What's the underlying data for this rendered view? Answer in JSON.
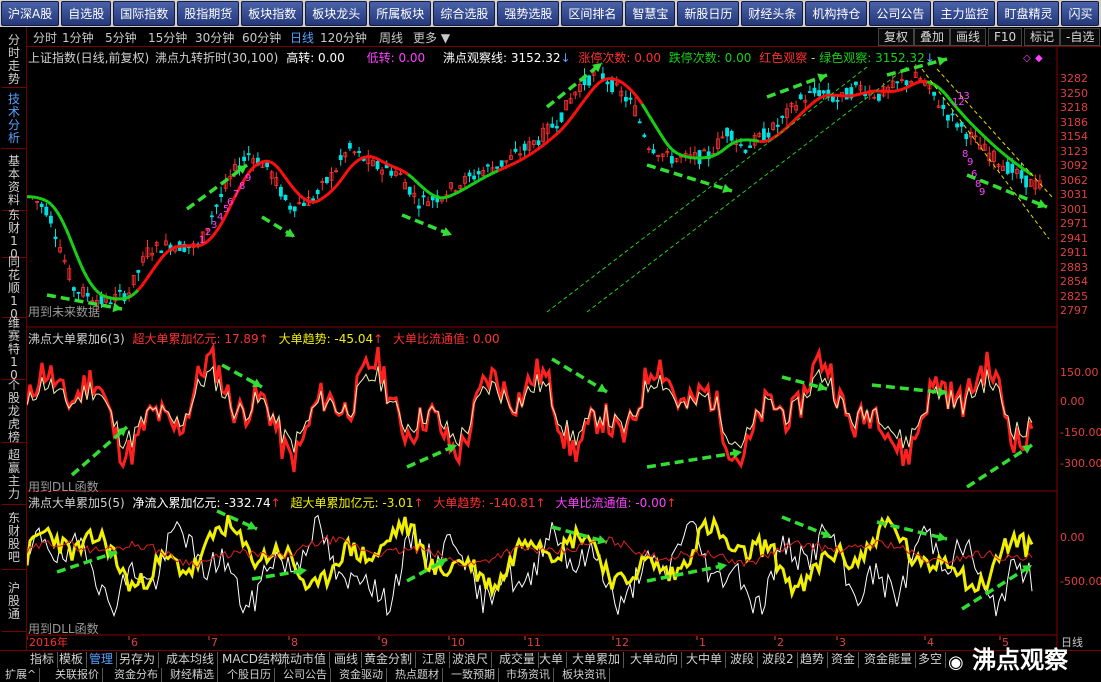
{
  "top_menu": [
    "沪深A股",
    "自选股",
    "国际指数",
    "股指期货",
    "板块指数",
    "板块龙头",
    "所属板块",
    "综合选股",
    "强势选股",
    "区间排名",
    "智慧宝",
    "新股日历",
    "财经头条",
    "机构持仓",
    "公司公告",
    "主力监控",
    "盯盘精灵",
    "闪买"
  ],
  "left_tabs": [
    "分时走势",
    "技术分析",
    "基本资料",
    "东财10",
    "同花顺10",
    "维赛特10",
    "个股龙虎榜",
    "超赢主力",
    "东财股吧",
    "沪股通"
  ],
  "period_bar": {
    "items": [
      "分时",
      "1分钟",
      "5分钟",
      "15分钟",
      "30分钟",
      "60分钟",
      "日线",
      "120分钟",
      "周线",
      "更多 ▼"
    ],
    "right_buttons": [
      "复权",
      "叠加",
      "画线",
      "F10",
      "标记",
      "-自选"
    ]
  },
  "panel1": {
    "title": "上证指数(日线,前复权)",
    "ind_name": "沸点九转折时(30,100)",
    "gaozhuan": "高转: 0.00",
    "dizhuan": "低转: 0.00",
    "guancha": "沸点观察线: 3152.32",
    "zhangting": "涨停次数: 0.00",
    "dieting": "跌停次数: 0.00",
    "red_obs": "红色观察",
    "green_obs": "绿色观察: 3152.32",
    "footer": "用到未来数据",
    "y_labels": [
      "3282",
      "3250",
      "3218",
      "3186",
      "3154",
      "3123",
      "3092",
      "3062",
      "3031",
      "3001",
      "2971",
      "2941",
      "2911",
      "2883",
      "2854",
      "2825",
      "2797"
    ],
    "seq_numbers": [
      "1",
      "2",
      "3",
      "4",
      "5",
      "6",
      "7",
      "8",
      "9",
      "12",
      "13",
      "8",
      "9",
      "6",
      "8",
      "9"
    ]
  },
  "panel2": {
    "title": "沸点大单累加6(3)",
    "c1": "超大单累加亿元: 17.89",
    "c2": "大单趋势: -45.04",
    "c3": "大单比流通值: 0.00",
    "footer": "用到DLL函数",
    "y_labels": [
      "150.00",
      "0.00",
      "-150.00",
      "-300.00"
    ]
  },
  "panel3": {
    "title": "沸点大单累加5(5)",
    "c1": "净流入累加亿元: -332.74",
    "c2": "超大单累加亿元: -3.01",
    "c3": "大单趋势: -140.81",
    "c4": "大单比流通值: -0.00",
    "footer": "用到DLL函数",
    "y_labels": [
      "0.00",
      "-500.00"
    ]
  },
  "x_axis": [
    "2016年",
    "6",
    "7",
    "8",
    "9",
    "10",
    "11",
    "12",
    "1",
    "2",
    "3",
    "4",
    "5"
  ],
  "x_axis_right": "日线",
  "bottom_tabs": [
    "指标",
    "模板",
    "管理",
    "另存为",
    "成本均线",
    "MACD结构",
    "流动市值",
    "画线",
    "黄金分割",
    "江恩",
    "波浪尺",
    "成交量",
    "大单",
    "大单累加",
    "大单动向",
    "大中单",
    "波段",
    "波段2",
    "趋势",
    "资金",
    "资金能量",
    "多空"
  ],
  "bottom_links": [
    "扩展^",
    "关联报价",
    "资金分布",
    "财经精选",
    "个股日历",
    "公司公告",
    "资金驱动",
    "热点题材",
    "一致预期",
    "市场资讯",
    "板块资讯"
  ],
  "watermark": "沸点观察",
  "colors": {
    "up": "#ff3030",
    "down": "#00e0e0",
    "ma_red": "#ff1010",
    "ma_green": "#18d018",
    "yellow": "#f0f000",
    "magenta": "#ff40ff",
    "arrow": "#33dd33"
  }
}
